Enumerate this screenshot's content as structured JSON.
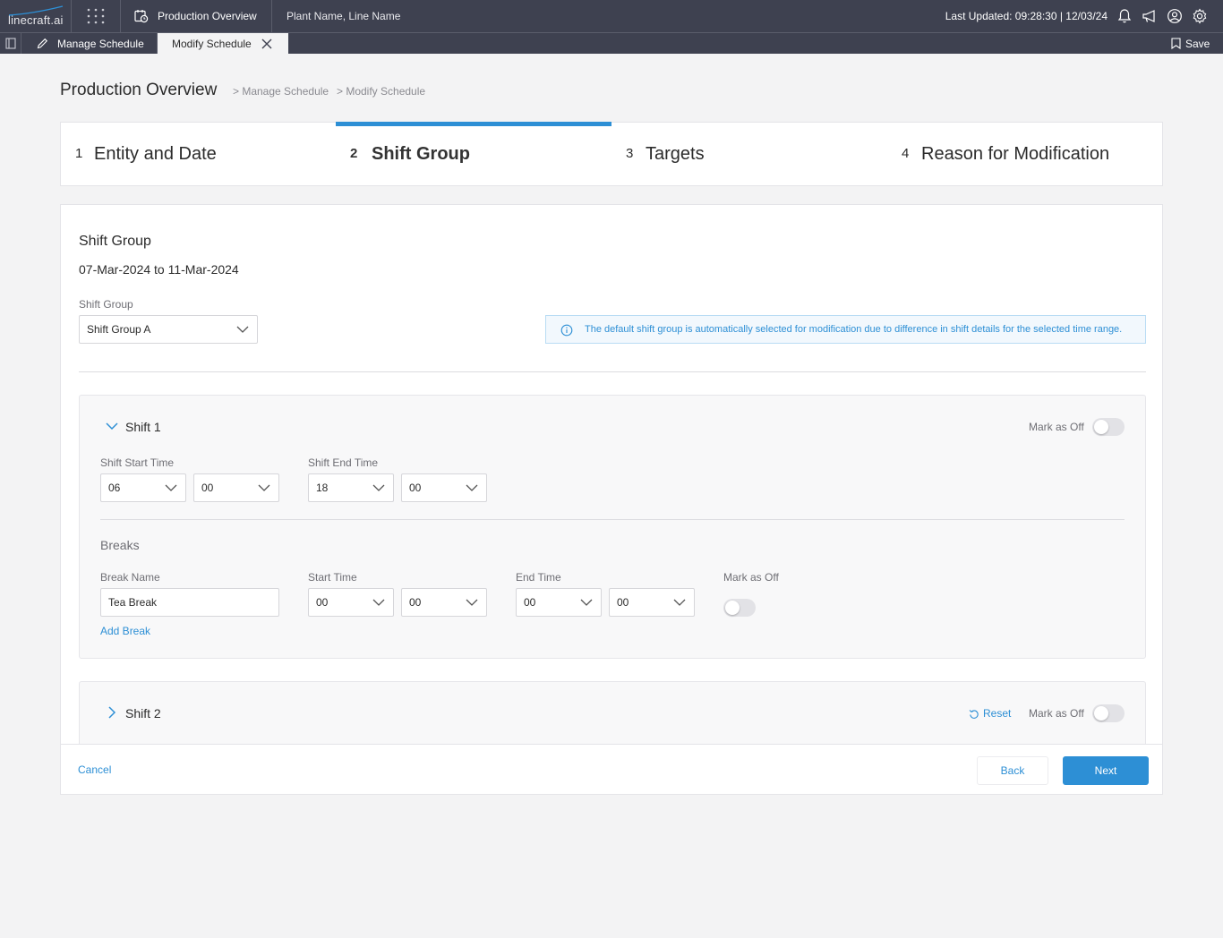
{
  "app": {
    "logo_text": "linecraft.ai",
    "module_name": "Production Overview",
    "plant_line": "Plant Name, Line Name",
    "last_updated": "Last Updated: 09:28:30 | 12/03/24"
  },
  "tabs": {
    "tab1_label": "Manage Schedule",
    "tab2_label": "Modify Schedule",
    "save_label": "Save"
  },
  "header": {
    "title": "Production Overview",
    "breadcrumb_1": "> Manage Schedule",
    "breadcrumb_2": "> Modify Schedule"
  },
  "stepper": {
    "steps": [
      {
        "num": "1",
        "label": "Entity and Date"
      },
      {
        "num": "2",
        "label": "Shift Group"
      },
      {
        "num": "3",
        "label": "Targets"
      },
      {
        "num": "4",
        "label": "Reason for Modification"
      }
    ],
    "active_step": 2
  },
  "form": {
    "section_title": "Shift Group",
    "date_range": "07-Mar-2024 to 11-Mar-2024",
    "shift_group_label": "Shift Group",
    "shift_group_value": "Shift Group A",
    "info_text": "The default shift group is automatically selected for modification due to difference in shift details for the selected time range."
  },
  "shift1": {
    "title": "Shift 1",
    "mark_off_label": "Mark as Off",
    "start_label": "Shift Start Time",
    "start_hour": "06",
    "start_min": "00",
    "end_label": "Shift End Time",
    "end_hour": "18",
    "end_min": "00",
    "breaks_title": "Breaks",
    "break_name_label": "Break Name",
    "break_name_value": "Tea Break",
    "break_start_label": "Start Time",
    "break_start_hour": "00",
    "break_start_min": "00",
    "break_end_label": "End Time",
    "break_end_hour": "00",
    "break_end_min": "00",
    "break_mark_off_label": "Mark as Off",
    "add_break": "Add Break"
  },
  "shift2": {
    "title": "Shift 2",
    "reset_label": "Reset",
    "mark_off_label": "Mark as Off"
  },
  "footer": {
    "cancel": "Cancel",
    "back": "Back",
    "next": "Next"
  },
  "colors": {
    "accent": "#2d8fd5",
    "topbar": "#3e4150",
    "background": "#f3f3f4"
  }
}
